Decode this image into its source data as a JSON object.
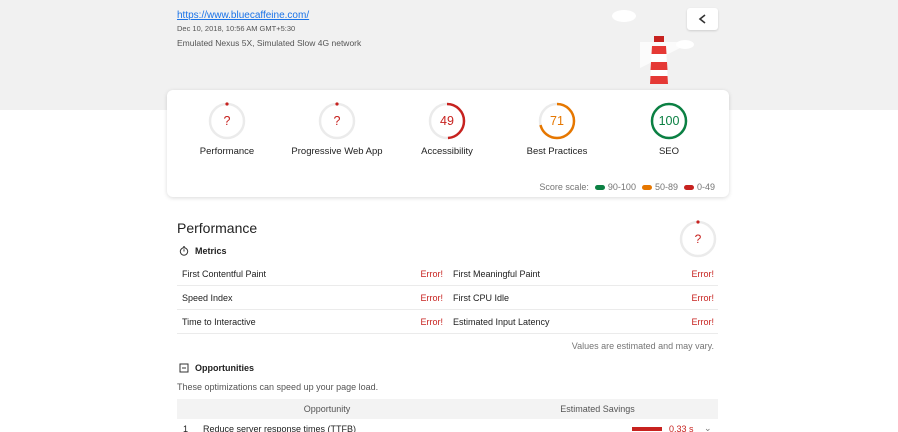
{
  "header": {
    "url": "https://www.bluecaffeine.com/",
    "date": "Dec 10, 2018, 10:56 AM GMT+5:30",
    "environment": "Emulated Nexus 5X, Simulated Slow 4G network",
    "share_icon": "share-icon"
  },
  "scores": [
    {
      "label": "Performance",
      "value": "?",
      "status": "error",
      "color": "#c7221f"
    },
    {
      "label": "Progressive Web App",
      "value": "?",
      "status": "error",
      "color": "#c7221f"
    },
    {
      "label": "Accessibility",
      "value": "49",
      "score": 0.49,
      "color": "#c7221f"
    },
    {
      "label": "Best Practices",
      "value": "71",
      "score": 0.71,
      "color": "#e67700"
    },
    {
      "label": "SEO",
      "value": "100",
      "score": 1.0,
      "color": "#0b8043"
    }
  ],
  "scale": {
    "label": "Score scale:",
    "ranges": [
      {
        "text": "90-100",
        "color": "#0b8043"
      },
      {
        "text": "50-89",
        "color": "#e67700"
      },
      {
        "text": "0-49",
        "color": "#c7221f"
      }
    ]
  },
  "performance": {
    "title": "Performance",
    "gauge_value": "?",
    "metrics_title": "Metrics",
    "metrics": [
      {
        "left": "First Contentful Paint",
        "left_val": "Error!",
        "right": "First Meaningful Paint",
        "right_val": "Error!"
      },
      {
        "left": "Speed Index",
        "left_val": "Error!",
        "right": "First CPU Idle",
        "right_val": "Error!"
      },
      {
        "left": "Time to Interactive",
        "left_val": "Error!",
        "right": "Estimated Input Latency",
        "right_val": "Error!"
      }
    ],
    "note": "Values are estimated and may vary.",
    "opportunities_title": "Opportunities",
    "opportunities_desc": "These optimizations can speed up your page load.",
    "table_headers": [
      "Opportunity",
      "Estimated Savings"
    ],
    "opp_rows": [
      {
        "num": "1",
        "name": "Reduce server response times (TTFB)",
        "saving": "0.33 s"
      }
    ]
  },
  "colors": {
    "error": "#c7221f",
    "orange": "#e67700",
    "green": "#0b8043"
  }
}
